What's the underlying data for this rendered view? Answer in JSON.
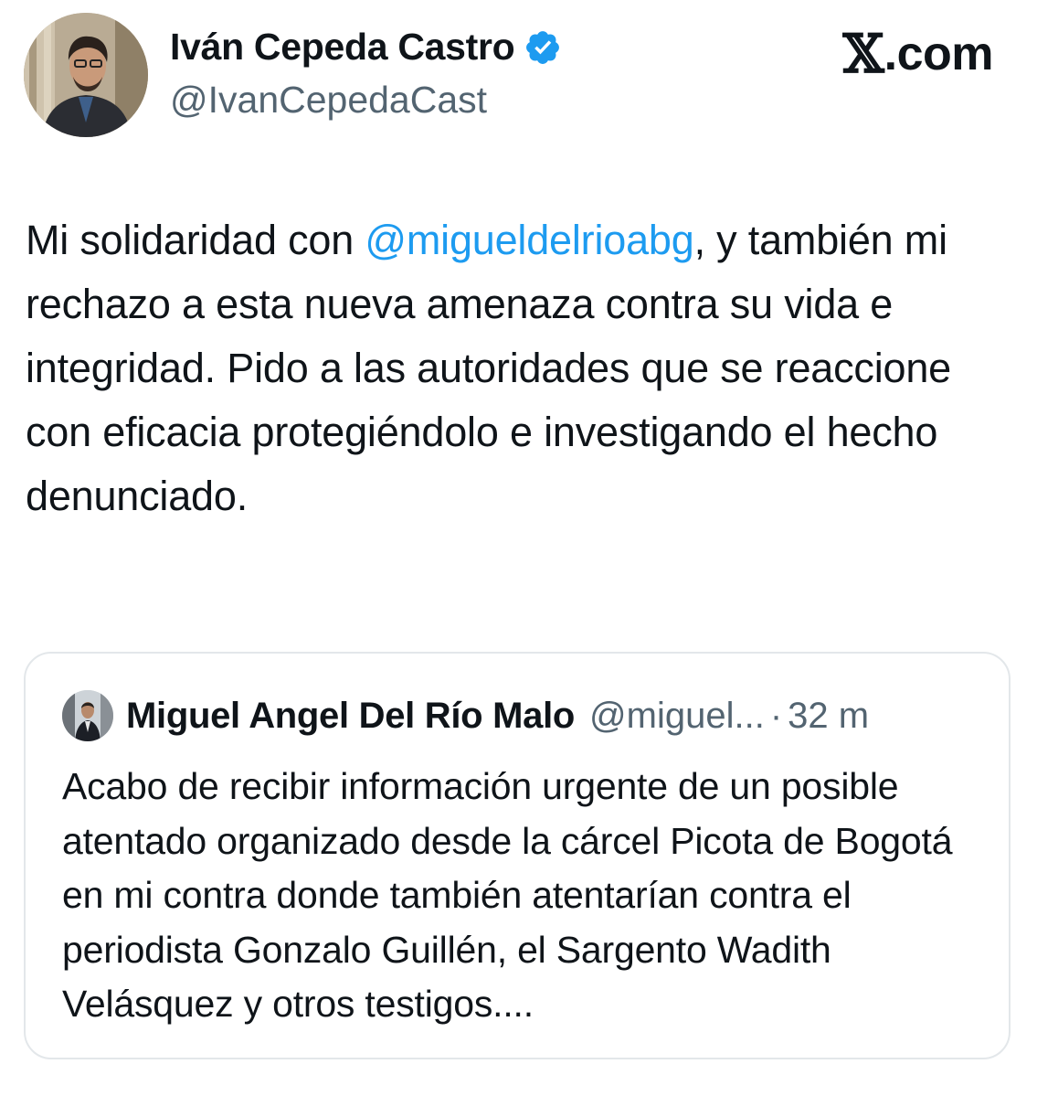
{
  "author": {
    "name": "Iván Cepeda Castro",
    "handle": "@IvanCepedaCast",
    "verified": true
  },
  "brand": {
    "mark": "𝕏",
    "suffix": ".com"
  },
  "tweet": {
    "text_before": "Mi solidaridad con ",
    "mention": "@migueldelrioabg",
    "text_after": ", y también mi rechazo a esta nueva amenaza contra su vida e integridad. Pido a las autoridades que se reaccione con eficacia protegiéndolo e investigando el hecho denunciado."
  },
  "quoted_tweet": {
    "author_name": "Miguel Angel Del Río Malo",
    "handle": "@miguel...",
    "separator": "·",
    "time": "32 m",
    "text": "Acabo de recibir información urgente de un posible atentado organizado desde la cárcel Picota de Bogotá en mi contra donde también atentarían contra el periodista Gonzalo Guillén, el Sargento Wadith Velásquez y otros testigos...."
  },
  "colors": {
    "link": "#1d9bf0",
    "secondary_text": "#536471",
    "verified_badge": "#1d9bf0",
    "quote_border": "#e3e7ea"
  },
  "icons": {
    "verified": "verified-badge-icon",
    "brand": "x-logo-icon"
  }
}
